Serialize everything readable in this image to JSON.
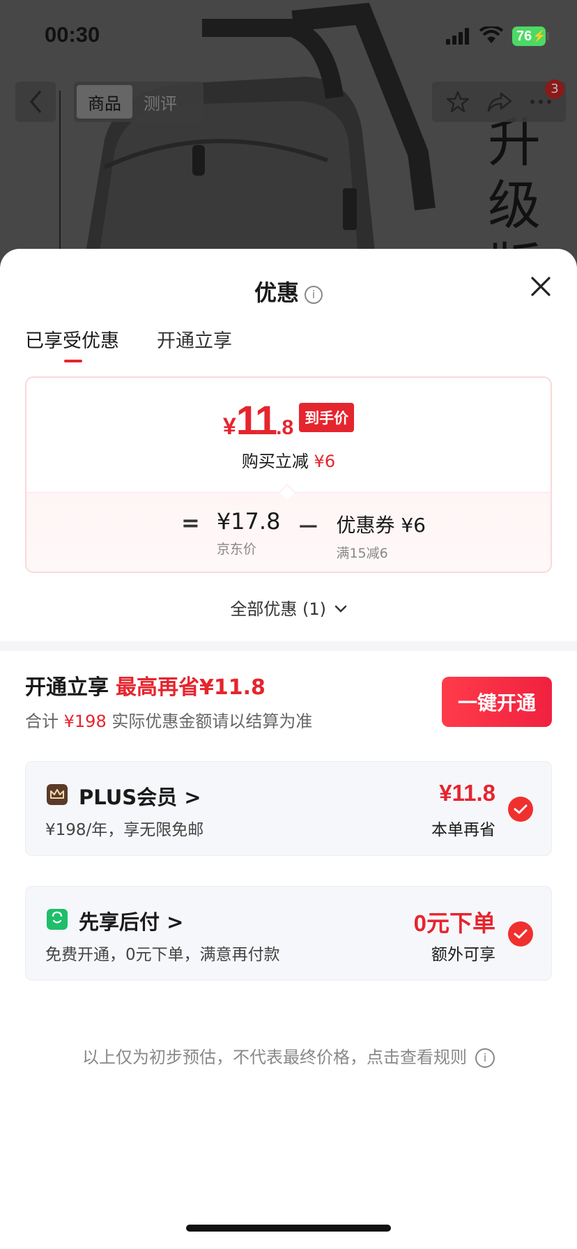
{
  "status_bar": {
    "time": "00:30",
    "battery": "76"
  },
  "nav": {
    "tabs": [
      "商品",
      "测评"
    ],
    "badge_count": "3"
  },
  "background": {
    "overlay_text": "升级版"
  },
  "sheet": {
    "title": "优惠",
    "tabs": [
      "已享受优惠",
      "开通立享"
    ],
    "price_card": {
      "currency": "¥",
      "price_integer": "11",
      "price_decimal": ".8",
      "arrive_tag": "到手价",
      "sub_label": "购买立减",
      "sub_value": "¥6",
      "equals": "=",
      "minus": "－",
      "jd_price": "¥17.8",
      "jd_price_label": "京东价",
      "coupon_value": "优惠券 ¥6",
      "coupon_rule": "满15减6"
    },
    "all_deals": "全部优惠 (1)",
    "open_section": {
      "title": "开通立享",
      "highlight": "最高再省¥11.8",
      "sub_prefix": "合计",
      "sub_total": "¥198",
      "sub_note": "实际优惠金额请以结算为准",
      "button": "一键开通"
    },
    "options": [
      {
        "name": "PLUS会员 >",
        "desc": "¥198/年，享无限免邮",
        "value": "¥11.8",
        "value_sub": "本单再省",
        "icon": "crown-icon",
        "icon_color": "#5a3b2a"
      },
      {
        "name": "先享后付 >",
        "desc": "免费开通，0元下单，满意再付款",
        "value": "0元下单",
        "value_sub": "额外可享",
        "icon": "shopping-bag-icon",
        "icon_color": "#1fbe6b"
      }
    ],
    "disclaimer": "以上仅为初步预估，不代表最终价格，点击查看规则"
  },
  "colors": {
    "accent_red": "#e5252e",
    "check_red": "#f0302f"
  }
}
